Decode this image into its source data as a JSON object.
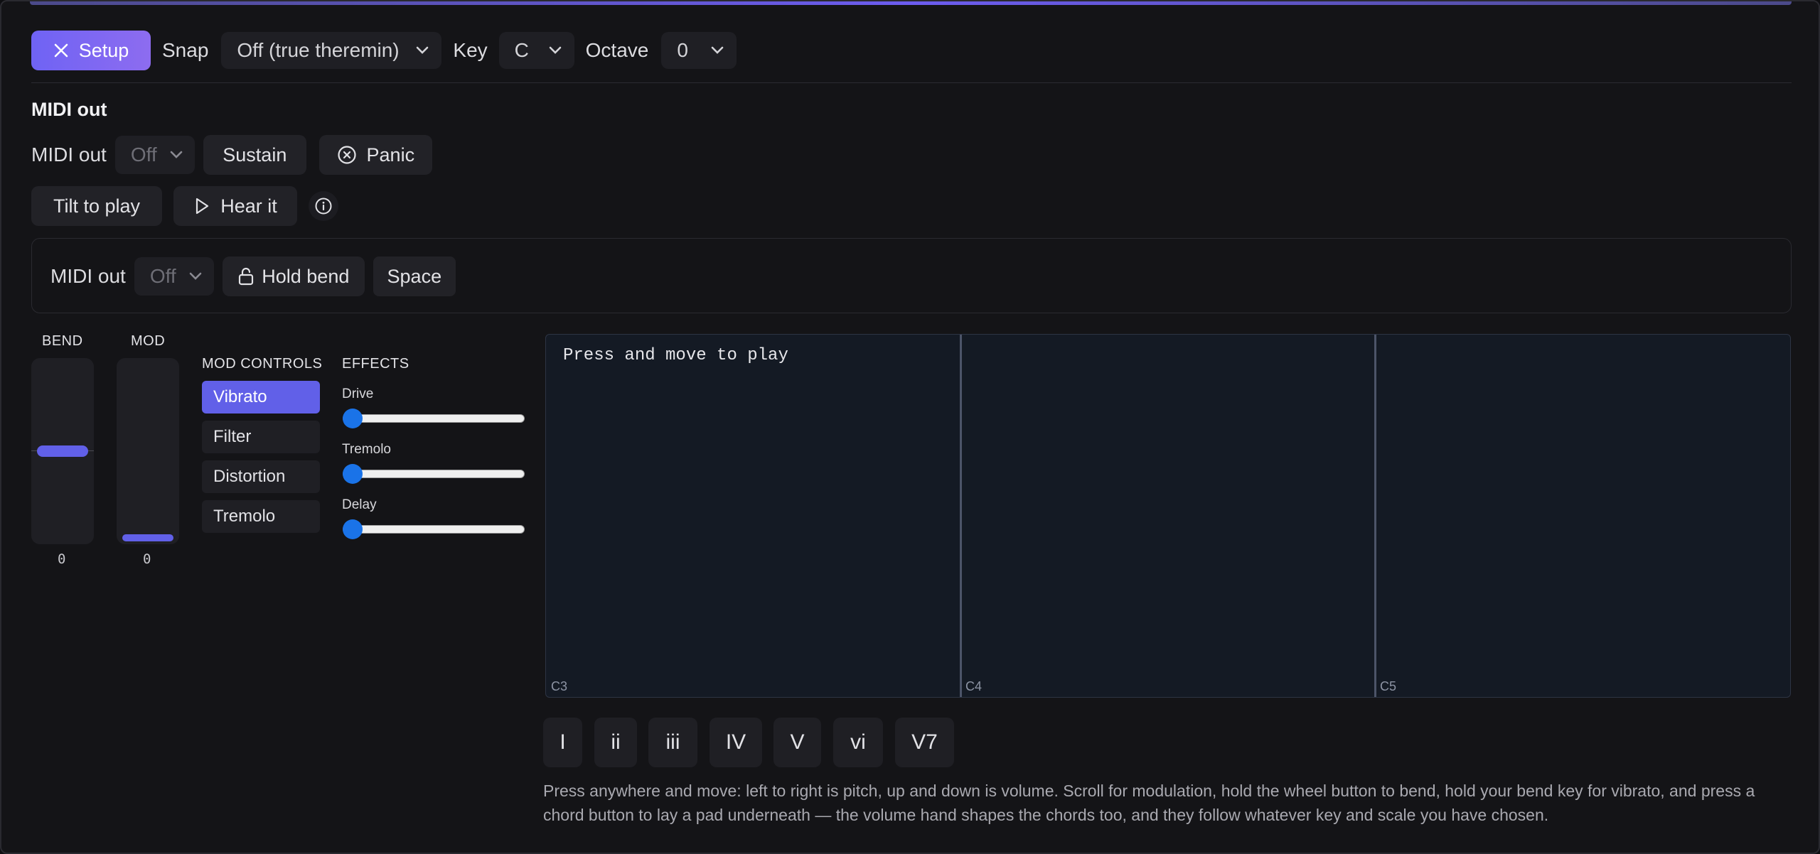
{
  "toolbar": {
    "setup_label": "Setup",
    "snap_label": "Snap",
    "snap_value": "Off (true theremin)",
    "key_label": "Key",
    "key_value": "C",
    "octave_label": "Octave",
    "octave_value": "0"
  },
  "midi_section": {
    "title": "MIDI out",
    "midi_out_label": "MIDI out",
    "midi_out_value": "Off",
    "sustain_label": "Sustain",
    "panic_label": "Panic",
    "tilt_label": "Tilt to play",
    "hear_label": "Hear it"
  },
  "panel": {
    "midi_out_label": "MIDI out",
    "midi_out_value": "Off",
    "hold_bend_label": "Hold bend",
    "space_label": "Space"
  },
  "bend": {
    "label": "BEND",
    "value": "0",
    "level": 0.5
  },
  "mod": {
    "label": "MOD",
    "value": "0",
    "level": 0.0
  },
  "mod_controls": {
    "title": "MOD CONTROLS",
    "items": [
      "Vibrato",
      "Filter",
      "Distortion",
      "Tremolo"
    ],
    "active": "Vibrato"
  },
  "effects": {
    "title": "EFFECTS",
    "sliders": [
      {
        "label": "Drive",
        "value": 0
      },
      {
        "label": "Tremolo",
        "value": 0
      },
      {
        "label": "Delay",
        "value": 0
      }
    ]
  },
  "pad": {
    "hint": "Press and move to play",
    "zones": [
      "C3",
      "C4",
      "C5"
    ]
  },
  "chords": [
    "I",
    "ii",
    "iii",
    "IV",
    "V",
    "vi",
    "V7"
  ],
  "description": "Press anywhere and move: left to right is pitch, up and down is volume. Scroll for modulation, hold the wheel button to bend, hold your bend key for vibrato, and press a chord button to lay a pad underneath — the volume hand shapes the chords too, and they follow whatever key and scale you have chosen.",
  "colors": {
    "accent": "#6f63f4",
    "mod_active": "#6160e8",
    "slider_knob": "#1a73e8",
    "pad_bg": "#141a24"
  }
}
